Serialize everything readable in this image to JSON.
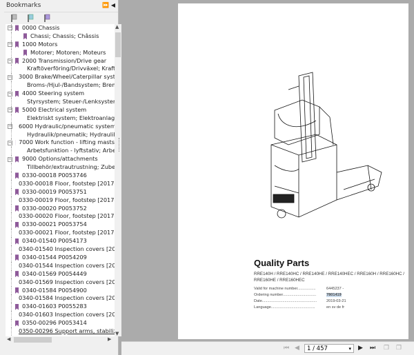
{
  "panel": {
    "title": "Bookmarks",
    "header_controls": "⏩ ◀"
  },
  "bookmarks": [
    {
      "label": "0000 Chassis",
      "level": 1
    },
    {
      "label": "Chassi; Chassis; Châssis",
      "level": 2
    },
    {
      "label": "1000 Motors",
      "level": 1
    },
    {
      "label": "Motorer; Motoren; Moteurs",
      "level": 2
    },
    {
      "label": "2000 Transmission/Drive gear",
      "level": 1
    },
    {
      "label": "Kraftöverföring/Drivväxel; Kraftü",
      "level": 2
    },
    {
      "label": "3000 Brake/Wheel/Caterpillar syste",
      "level": 1
    },
    {
      "label": "Broms-/Hjul-/Bandsystem; Brem",
      "level": 2
    },
    {
      "label": "4000 Steering system",
      "level": 1
    },
    {
      "label": "Styrsystem; Steuer-/Lenksyster",
      "level": 2
    },
    {
      "label": "5000 Electrical system",
      "level": 1
    },
    {
      "label": "Elektriskt system; Elektroanlage",
      "level": 2
    },
    {
      "label": "6000 Hydraulic/pneumatic system",
      "level": 1
    },
    {
      "label": "Hydraulik/pneumatik; Hydraulika",
      "level": 2
    },
    {
      "label": "7000 Work function - lifting masts",
      "level": 1
    },
    {
      "label": "Arbetsfunktion - lyftstativ; Arbe",
      "level": 2
    },
    {
      "label": "9000 Options/attachments",
      "level": 1
    },
    {
      "label": "Tillbehör/extrautrustning; Zube",
      "level": 2
    },
    {
      "label": "0330-00018 P0053746",
      "level": 0
    },
    {
      "label": "0330-00018 Floor, footstep [2017-",
      "level": 0
    },
    {
      "label": "0330-00019 P0053751",
      "level": 0
    },
    {
      "label": "0330-00019 Floor, footstep [2017-",
      "level": 0
    },
    {
      "label": "0330-00020 P0053752",
      "level": 0
    },
    {
      "label": "0330-00020 Floor, footstep [2017-",
      "level": 0
    },
    {
      "label": "0330-00021 P0053754",
      "level": 0
    },
    {
      "label": "0330-00021 Floor, footstep [2017-",
      "level": 0
    },
    {
      "label": "0340-01540 P0054173",
      "level": 0
    },
    {
      "label": "0340-01540 Inspection covers [20",
      "level": 0
    },
    {
      "label": "0340-01544 P0054209",
      "level": 0
    },
    {
      "label": "0340-01544 Inspection covers [20",
      "level": 0
    },
    {
      "label": "0340-01569 P0054449",
      "level": 0
    },
    {
      "label": "0340-01569 Inspection covers [20",
      "level": 0
    },
    {
      "label": "0340-01584 P0054900",
      "level": 0
    },
    {
      "label": "0340-01584 Inspection covers [20",
      "level": 0
    },
    {
      "label": "0340-01603 P0055283",
      "level": 0
    },
    {
      "label": "0340-01603 Inspection covers [20",
      "level": 0
    },
    {
      "label": "0350-00296 P0053414",
      "level": 0
    },
    {
      "label": "0350-00296 Support arms, stabilize",
      "level": 0
    }
  ],
  "document": {
    "title": "Quality Parts",
    "models": "RRE140H / RRE140HC / RRE140HE / RRE140HEC / RRE160H / RRE160HC / RRE160HE / RRE160HEC",
    "fields": [
      {
        "label": "Valid for machine number.................",
        "value": "6445237 -"
      },
      {
        "label": "Ordering number...............................",
        "value": "7801419"
      },
      {
        "label": "Date...................................................",
        "value": "2019-03-21"
      },
      {
        "label": "Language.........................................",
        "value": "en sv de fr"
      }
    ]
  },
  "toolbar": {
    "page_indicator": "1 / 457"
  },
  "colors": {
    "bookmark": "#8e5a9a",
    "viewer_bg": "#ababab",
    "panel_bg": "#f0f0f0"
  }
}
